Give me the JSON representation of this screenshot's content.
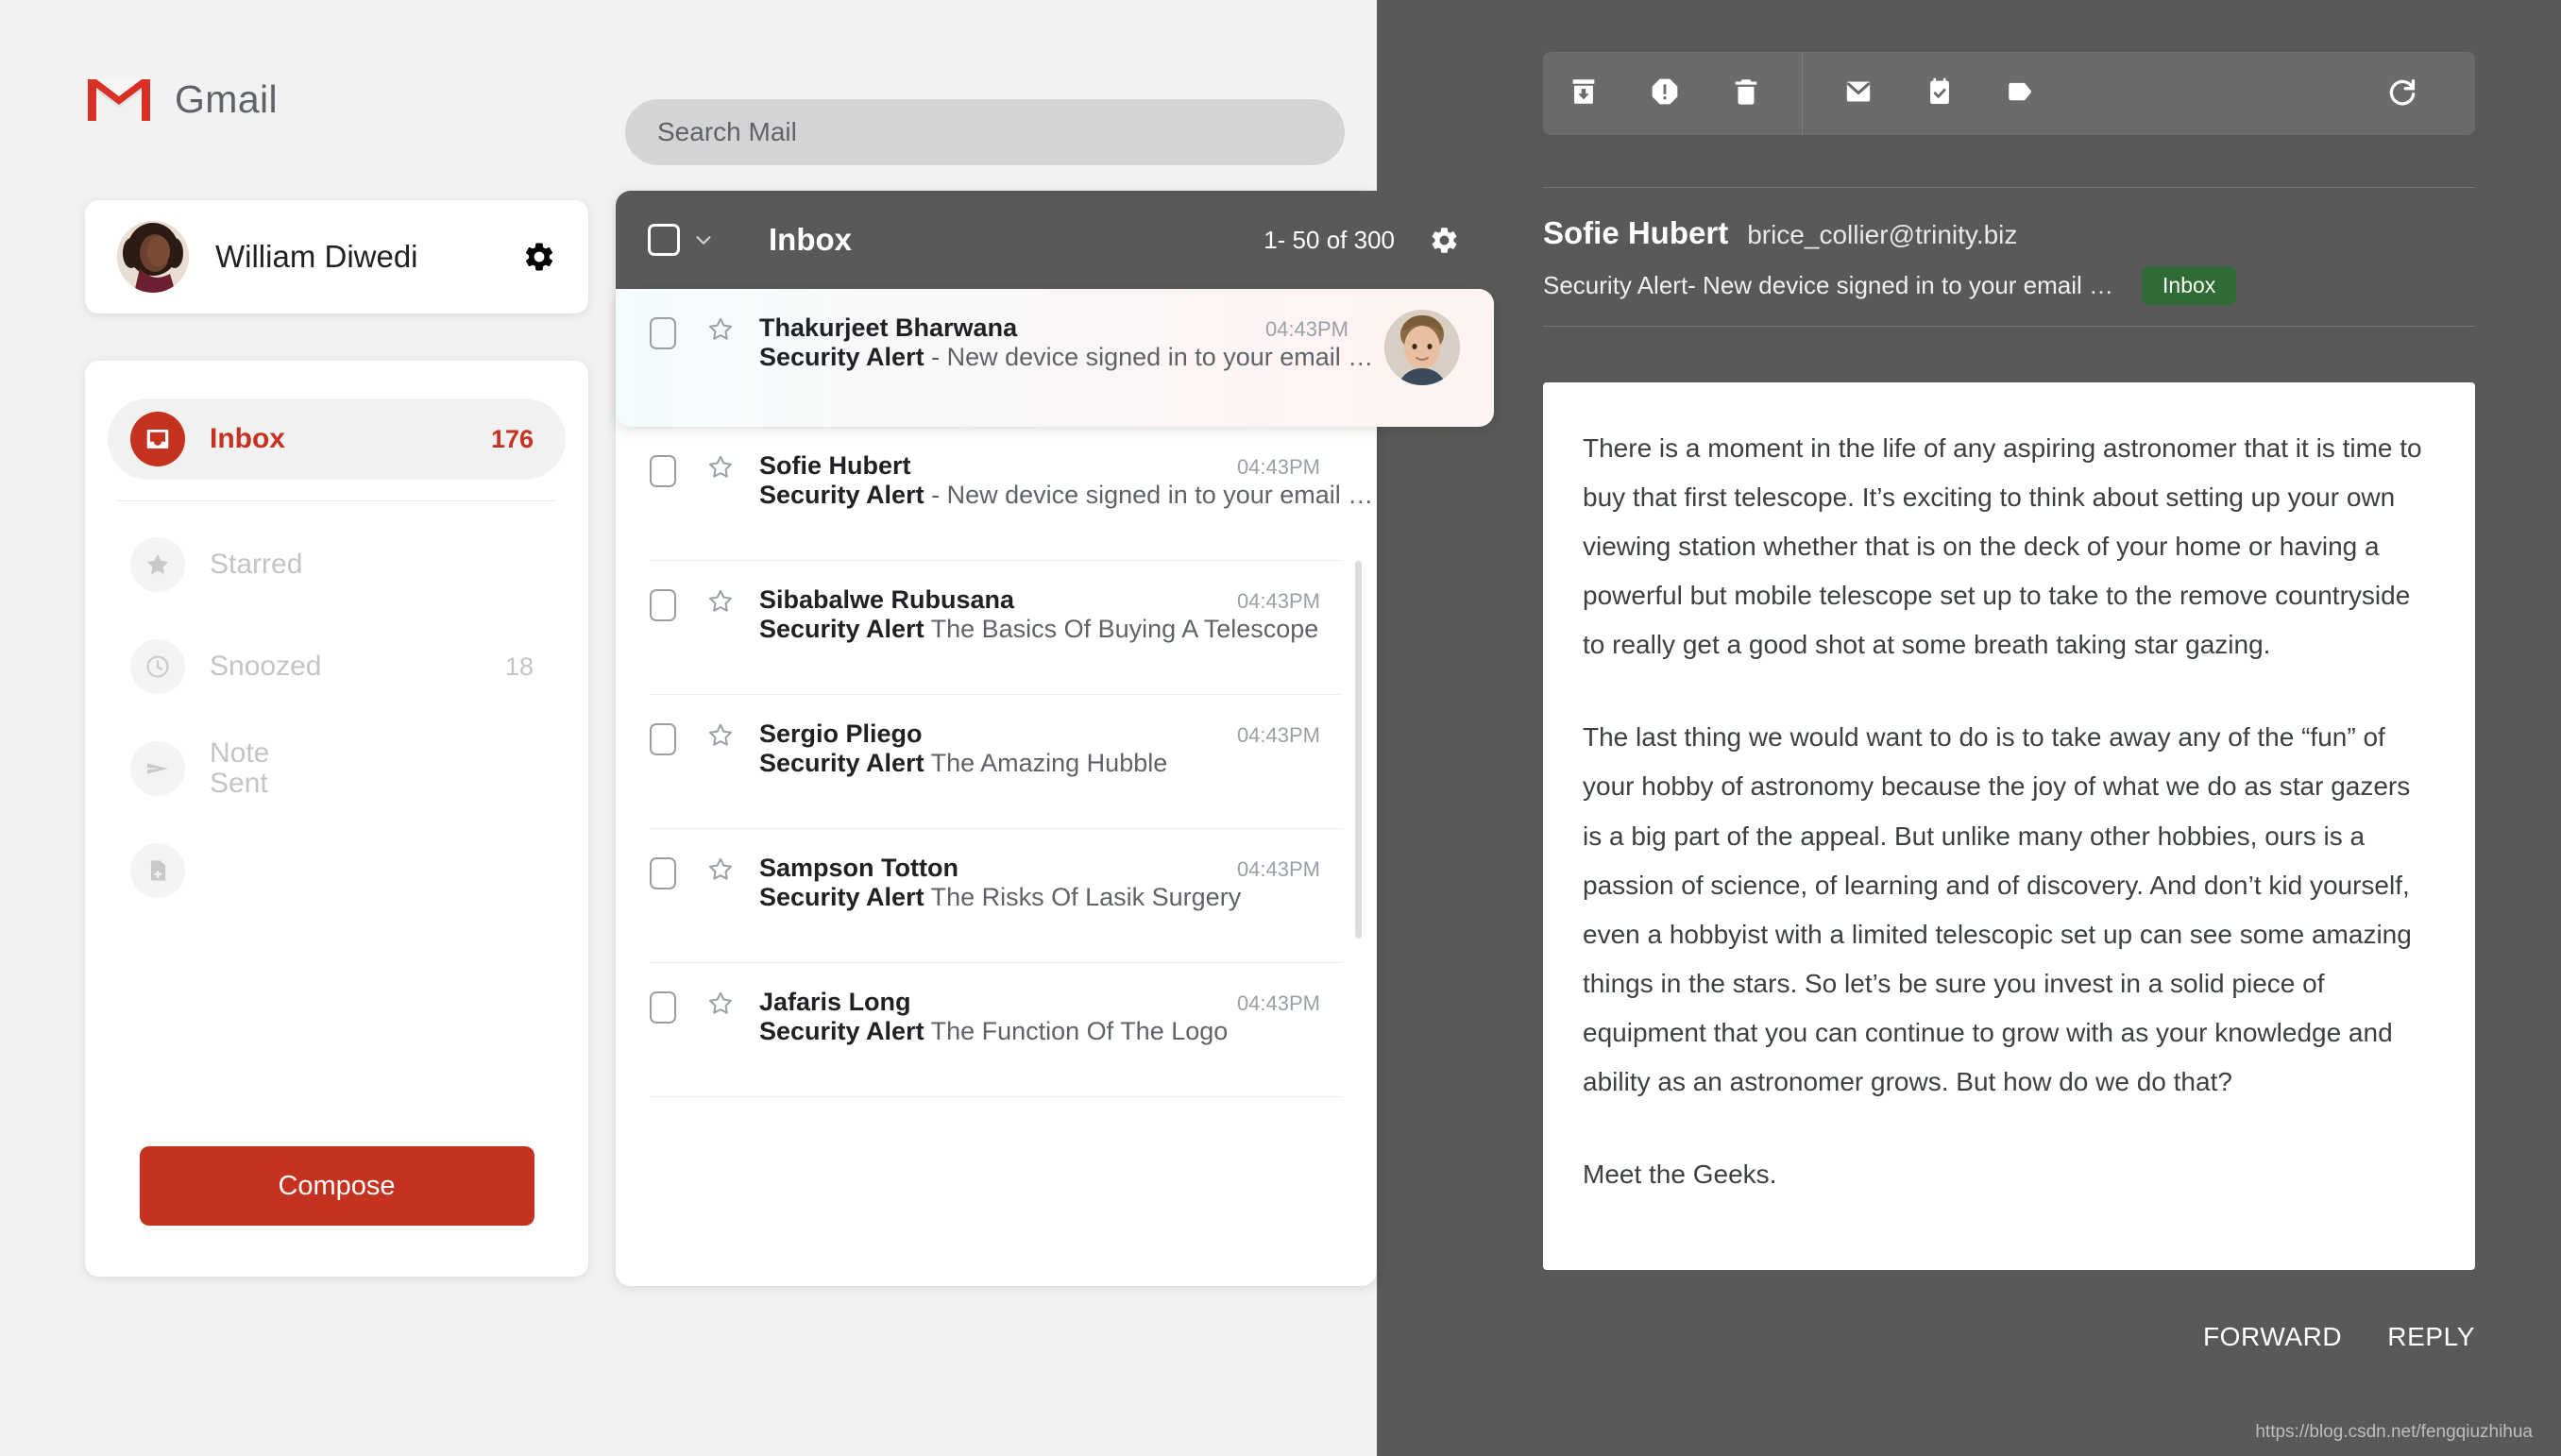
{
  "brand": {
    "name": "Gmail",
    "logo_icon": "gmail-logo-icon"
  },
  "search": {
    "placeholder": "Search Mail",
    "value": ""
  },
  "profile": {
    "name": "William Diwedi",
    "settings_icon": "gear-icon",
    "avatar_icon": "avatar"
  },
  "sidebar": {
    "items": [
      {
        "label": "Inbox",
        "count": "176",
        "icon": "inbox-icon",
        "active": true
      },
      {
        "label": "Starred",
        "count": "",
        "icon": "star-icon",
        "active": false
      },
      {
        "label": "Snoozed",
        "count": "18",
        "icon": "clock-icon",
        "active": false
      },
      {
        "label": "Note",
        "label2": "Sent",
        "count": "",
        "icon": "send-icon",
        "active": false
      },
      {
        "label": "",
        "count": "",
        "icon": "file-add-icon",
        "active": false
      }
    ],
    "compose_label": "Compose"
  },
  "list": {
    "title": "Inbox",
    "pagination": "1- 50 of 300",
    "select_all_icon": "checkbox-icon",
    "select_all_chevron_icon": "chevron-down-icon",
    "settings_icon": "gear-icon",
    "rows": [
      {
        "sender": "Thakurjeet Bharwana",
        "time": "04:43PM",
        "subject": "Security Alert",
        "snippet": " - New device signed in to your email …",
        "selected": true,
        "has_avatar": true
      },
      {
        "sender": "Sofie Hubert",
        "time": "04:43PM",
        "subject": "Security Alert",
        "snippet": " - New device signed in to your email …",
        "selected": false,
        "has_avatar": false
      },
      {
        "sender": "Sibabalwe Rubusana",
        "time": "04:43PM",
        "subject": "Security Alert",
        "snippet": " The Basics Of Buying A Telescope",
        "selected": false,
        "has_avatar": false
      },
      {
        "sender": "Sergio Pliego",
        "time": "04:43PM",
        "subject": "Security Alert",
        "snippet": " The Amazing Hubble",
        "selected": false,
        "has_avatar": false
      },
      {
        "sender": "Sampson Totton",
        "time": "04:43PM",
        "subject": "Security Alert",
        "snippet": " The Risks Of Lasik Surgery",
        "selected": false,
        "has_avatar": false
      },
      {
        "sender": "Jafaris Long",
        "time": "04:43PM",
        "subject": "Security Alert",
        "snippet": " The Function Of The Logo",
        "selected": false,
        "has_avatar": false
      }
    ]
  },
  "reading_pane": {
    "toolbar": [
      {
        "icon": "archive-icon",
        "name": "archive-button"
      },
      {
        "icon": "report-spam-icon",
        "name": "report-spam-button"
      },
      {
        "icon": "delete-icon",
        "name": "delete-button"
      },
      {
        "icon": "mark-unread-icon",
        "name": "mark-unread-button"
      },
      {
        "icon": "add-to-tasks-icon",
        "name": "add-to-tasks-button"
      },
      {
        "icon": "label-icon",
        "name": "label-button"
      }
    ],
    "refresh_icon": "refresh-icon",
    "sender": "Sofie Hubert",
    "email": "brice_collier@trinity.biz",
    "subject": "Security Alert",
    "subject_rest": " - New device signed in to your email …",
    "badge": "Inbox",
    "body_paragraphs": [
      "There is a moment in the life of any aspiring astronomer that it is time to buy that first telescope. It’s exciting to think about setting up your own viewing station whether that is on the deck of your home or having a powerful but mobile telescope set up to take to the remove countryside to really get a good shot at some breath taking star gazing.",
      "The last thing we would want to do is to take away any of the “fun” of your hobby of astronomy because the joy of what we do as star gazers is a big part of the appeal. But unlike many other hobbies, ours is a passion of science, of learning and of discovery. And don’t kid yourself, even a hobbyist with a limited telescopic set up can see some amazing things in the stars. So let’s be sure you invest in a solid piece of equipment that you can continue to grow with as your knowledge and ability as an astronomer grows. But how do we do that?",
      "Meet the Geeks."
    ],
    "forward_label": "FORWARD",
    "reply_label": "REPLY"
  },
  "watermark": "https://blog.csdn.net/fengqiuzhihua",
  "colors": {
    "brand_red": "#c5321f",
    "dark_pane": "#595959",
    "toolbar": "#6b6b6b",
    "badge_green": "#2e6b35"
  }
}
